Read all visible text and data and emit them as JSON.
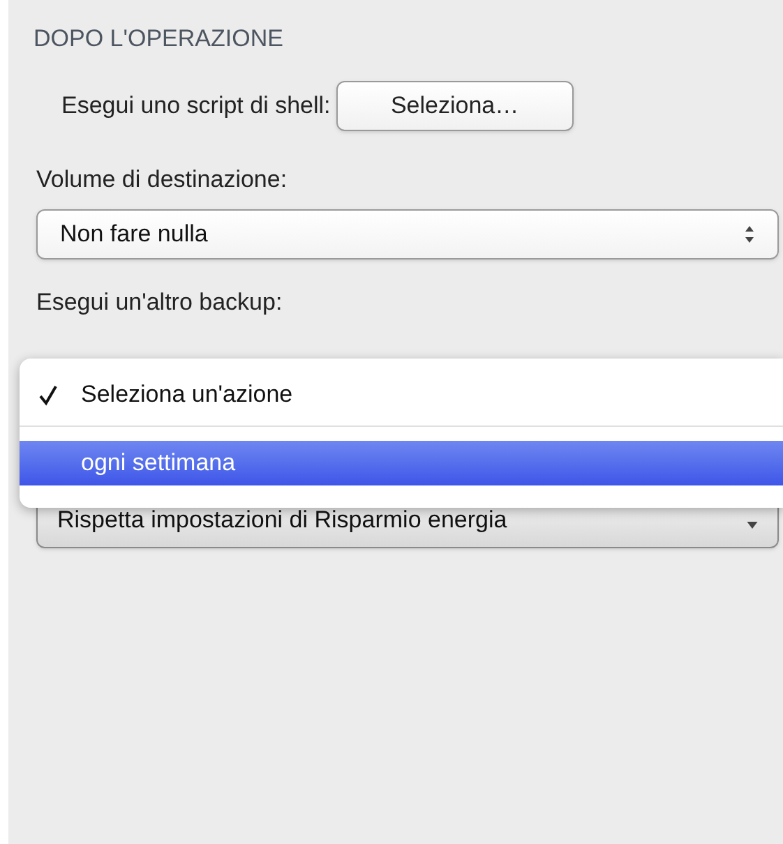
{
  "section": {
    "title": "DOPO L'OPERAZIONE"
  },
  "script_row": {
    "label": "Esegui uno script di shell:",
    "button": "Seleziona…"
  },
  "destination": {
    "label": "Volume di destinazione:",
    "value": "Non fare nulla"
  },
  "another_backup": {
    "label": "Esegui un'altro backup:",
    "menu": [
      {
        "label": "Seleziona un'azione",
        "checked": true,
        "selected": false
      },
      {
        "label": "ogni settimana",
        "checked": false,
        "selected": true
      }
    ]
  },
  "power": {
    "value": "Rispetta impostazioni di Risparmio energia"
  }
}
